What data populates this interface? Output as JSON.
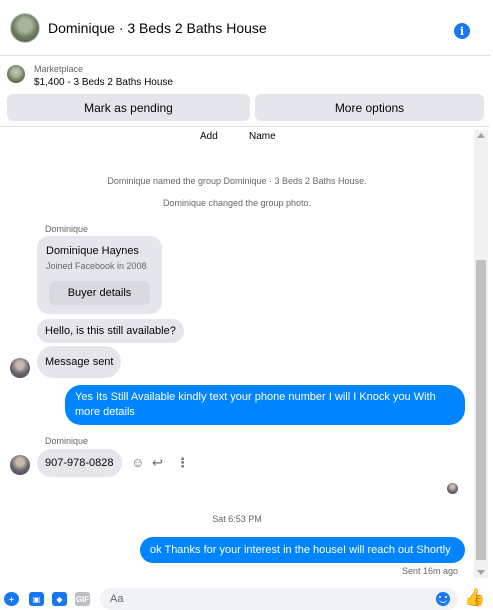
{
  "header": {
    "title": "Dominique · 3 Beds 2 Baths House",
    "info_icon": "info-icon",
    "info_glyph": "i"
  },
  "marketplace": {
    "label": "Marketplace",
    "listing": "$1,400 - 3 Beds 2 Baths House",
    "mark_pending": "Mark as pending",
    "more_options": "More options"
  },
  "conversation": {
    "partial_actions": [
      "Add",
      "Name"
    ],
    "system_messages": [
      "Dominique named the group Dominique · 3 Beds 2 Baths House.",
      "Dominique changed the group photo."
    ],
    "sender_1": "Dominique",
    "profile_card": {
      "name": "Dominique Haynes",
      "joined": "Joined Facebook in 2008",
      "button": "Buyer details"
    },
    "msg_available": "Hello, is this still available?",
    "msg_sent_notice": "Message sent",
    "reply_1": "Yes Its Still Available kindly text your phone number I will I Knock you With more details",
    "sender_2": "Dominique",
    "msg_phone": "907-978-0828",
    "timestamp": "Sat 6:53 PM",
    "reply_2": "ok Thanks for your interest in the houseI will reach out Shortly",
    "status": "Sent 16m ago"
  },
  "composer": {
    "placeholder": "Aa",
    "gif_label": "GIF"
  },
  "colors": {
    "accent": "#1877f2",
    "outgoing_bubble": "#0084ff",
    "incoming_bubble": "#e4e6eb"
  }
}
